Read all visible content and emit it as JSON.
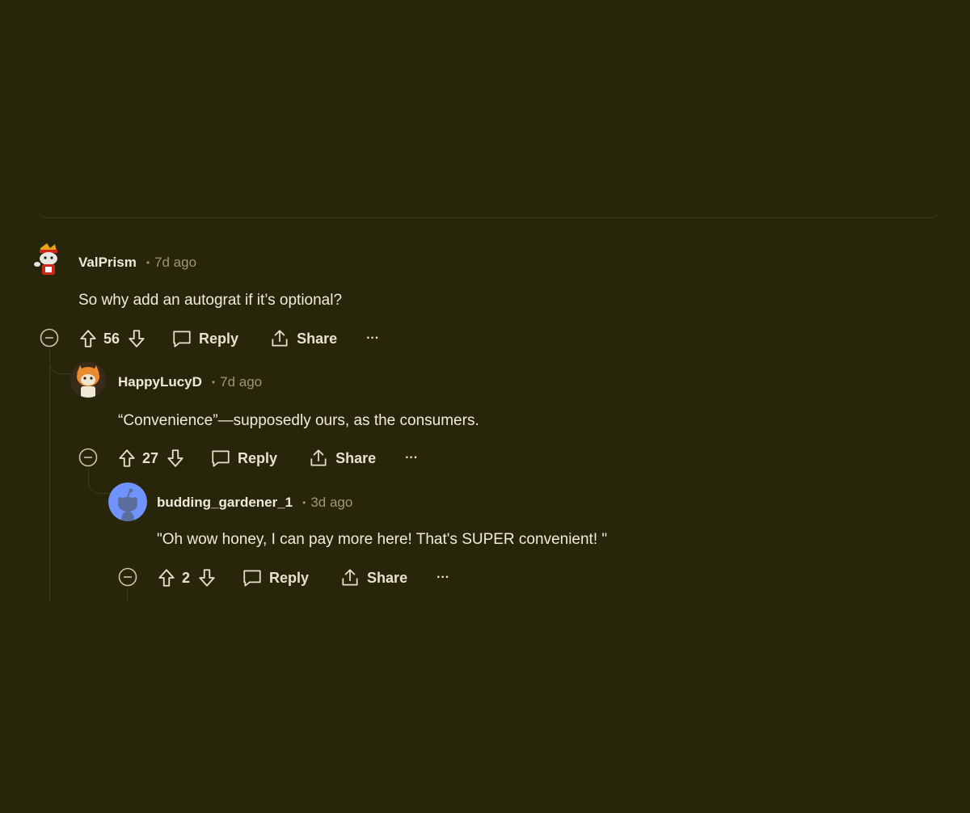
{
  "comments": [
    {
      "author": "ValPrism",
      "time": "7d ago",
      "body": "So why add an autograt if it’s optional?",
      "score": "56",
      "reply_label": "Reply",
      "share_label": "Share",
      "more_label": "···"
    },
    {
      "author": "HappyLucyD",
      "time": "7d ago",
      "body": "“Convenience”—supposedly ours, as the consumers.",
      "score": "27",
      "reply_label": "Reply",
      "share_label": "Share",
      "more_label": "···"
    },
    {
      "author": "budding_gardener_1",
      "time": "3d ago",
      "body": "\"Oh wow honey, I can pay more here! That's SUPER convenient! \"",
      "score": "2",
      "reply_label": "Reply",
      "share_label": "Share",
      "more_label": "···"
    }
  ],
  "separator": "•",
  "colors": {
    "background": "#27250a",
    "text": "#e6e2cf",
    "muted": "#9c977c",
    "thread_line": "#3d3b1d",
    "default_avatar": "#7193ff"
  }
}
